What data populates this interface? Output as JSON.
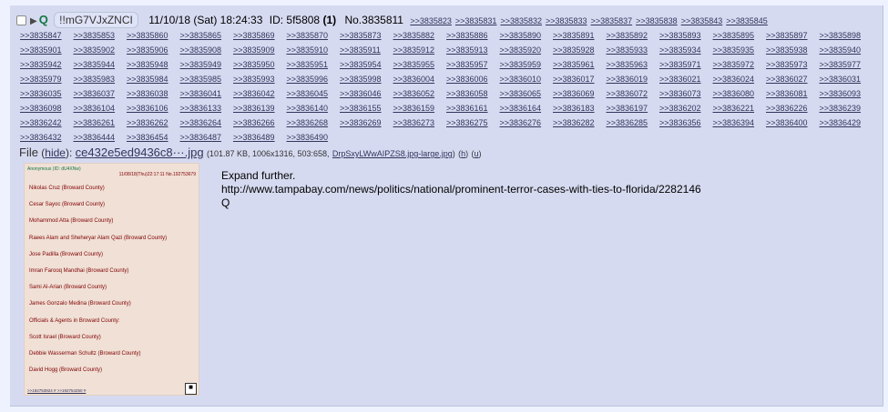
{
  "post": {
    "name": "Q",
    "tripcode": "!!mG7VJxZNCI",
    "date": "11/10/18 (Sat) 18:24:33",
    "id_label": "ID: 5f5808",
    "post_count": "(1)",
    "post_number": "No.3835811",
    "replies": [
      ">>3835823",
      ">>3835831",
      ">>3835832",
      ">>3835833",
      ">>3835837",
      ">>3835838",
      ">>3835843",
      ">>3835845",
      ">>3835847",
      ">>3835853",
      ">>3835860",
      ">>3835865",
      ">>3835869",
      ">>3835870",
      ">>3835873",
      ">>3835882",
      ">>3835886",
      ">>3835890",
      ">>3835891",
      ">>3835892",
      ">>3835893",
      ">>3835895",
      ">>3835897",
      ">>3835898",
      ">>3835901",
      ">>3835902",
      ">>3835906",
      ">>3835908",
      ">>3835909",
      ">>3835910",
      ">>3835911",
      ">>3835912",
      ">>3835913",
      ">>3835920",
      ">>3835928",
      ">>3835933",
      ">>3835934",
      ">>3835935",
      ">>3835938",
      ">>3835940",
      ">>3835942",
      ">>3835944",
      ">>3835948",
      ">>3835949",
      ">>3835950",
      ">>3835951",
      ">>3835954",
      ">>3835955",
      ">>3835957",
      ">>3835959",
      ">>3835961",
      ">>3835963",
      ">>3835971",
      ">>3835972",
      ">>3835973",
      ">>3835977",
      ">>3835979",
      ">>3835983",
      ">>3835984",
      ">>3835985",
      ">>3835993",
      ">>3835996",
      ">>3835998",
      ">>3836004",
      ">>3836006",
      ">>3836010",
      ">>3836017",
      ">>3836019",
      ">>3836021",
      ">>3836024",
      ">>3836027",
      ">>3836031",
      ">>3836035",
      ">>3836037",
      ">>3836038",
      ">>3836041",
      ">>3836042",
      ">>3836045",
      ">>3836046",
      ">>3836052",
      ">>3836058",
      ">>3836065",
      ">>3836069",
      ">>3836072",
      ">>3836073",
      ">>3836080",
      ">>3836081",
      ">>3836093",
      ">>3836098",
      ">>3836104",
      ">>3836106",
      ">>3836133",
      ">>3836139",
      ">>3836140",
      ">>3836155",
      ">>3836159",
      ">>3836161",
      ">>3836164",
      ">>3836183",
      ">>3836197",
      ">>3836202",
      ">>3836221",
      ">>3836226",
      ">>3836239",
      ">>3836242",
      ">>3836261",
      ">>3836262",
      ">>3836264",
      ">>3836266",
      ">>3836268",
      ">>3836269",
      ">>3836273",
      ">>3836275",
      ">>3836276",
      ">>3836282",
      ">>3836285",
      ">>3836356",
      ">>3836394",
      ">>3836400",
      ">>3836429",
      ">>3836432",
      ">>3836444",
      ">>3836454",
      ">>3836487",
      ">>3836489",
      ">>3836490"
    ],
    "file": {
      "label": "File",
      "hide_label": "hide",
      "filename": "ce432e5ed9436c8···.jpg",
      "meta": "(101.87 KB, 1006x1316, 503:658,",
      "orig_name": "DrpSxyLWwAIPZS8.jpg-large.jpg",
      "h_label": "h",
      "u_label": "u"
    },
    "thumbnail": {
      "header_left": "Anonymous (ID: dU4XNw)",
      "header_right": "11/08/18(Thu)22:17:11 No.192753679",
      "rows": [
        "Nikolas Cruz (Broward County)",
        "Cesar Sayoc (Broward County)",
        "Mohammod Atta (Broward County)",
        "Raees Alam and Sheheryar Alam Qazi (Broward County)",
        "Jose Padilla (Broward County)",
        "Imran Farooq Mandhai (Broward County)",
        "Sami Al-Arian (Broward County)",
        "James Gonzalo Medina (Broward County)",
        "Officials & Agents in Broward County:",
        "Scott Israel (Broward County)",
        "Debbie Wasserman Schultz (Broward County)",
        "David Hogg (Broward County)"
      ],
      "footer": ">>192753924 # >>192754250 #"
    },
    "message": "Expand further.\nhttp://www.tampabay.com/news/politics/national/prominent-terror-cases-with-ties-to-florida/2282146\nQ"
  }
}
